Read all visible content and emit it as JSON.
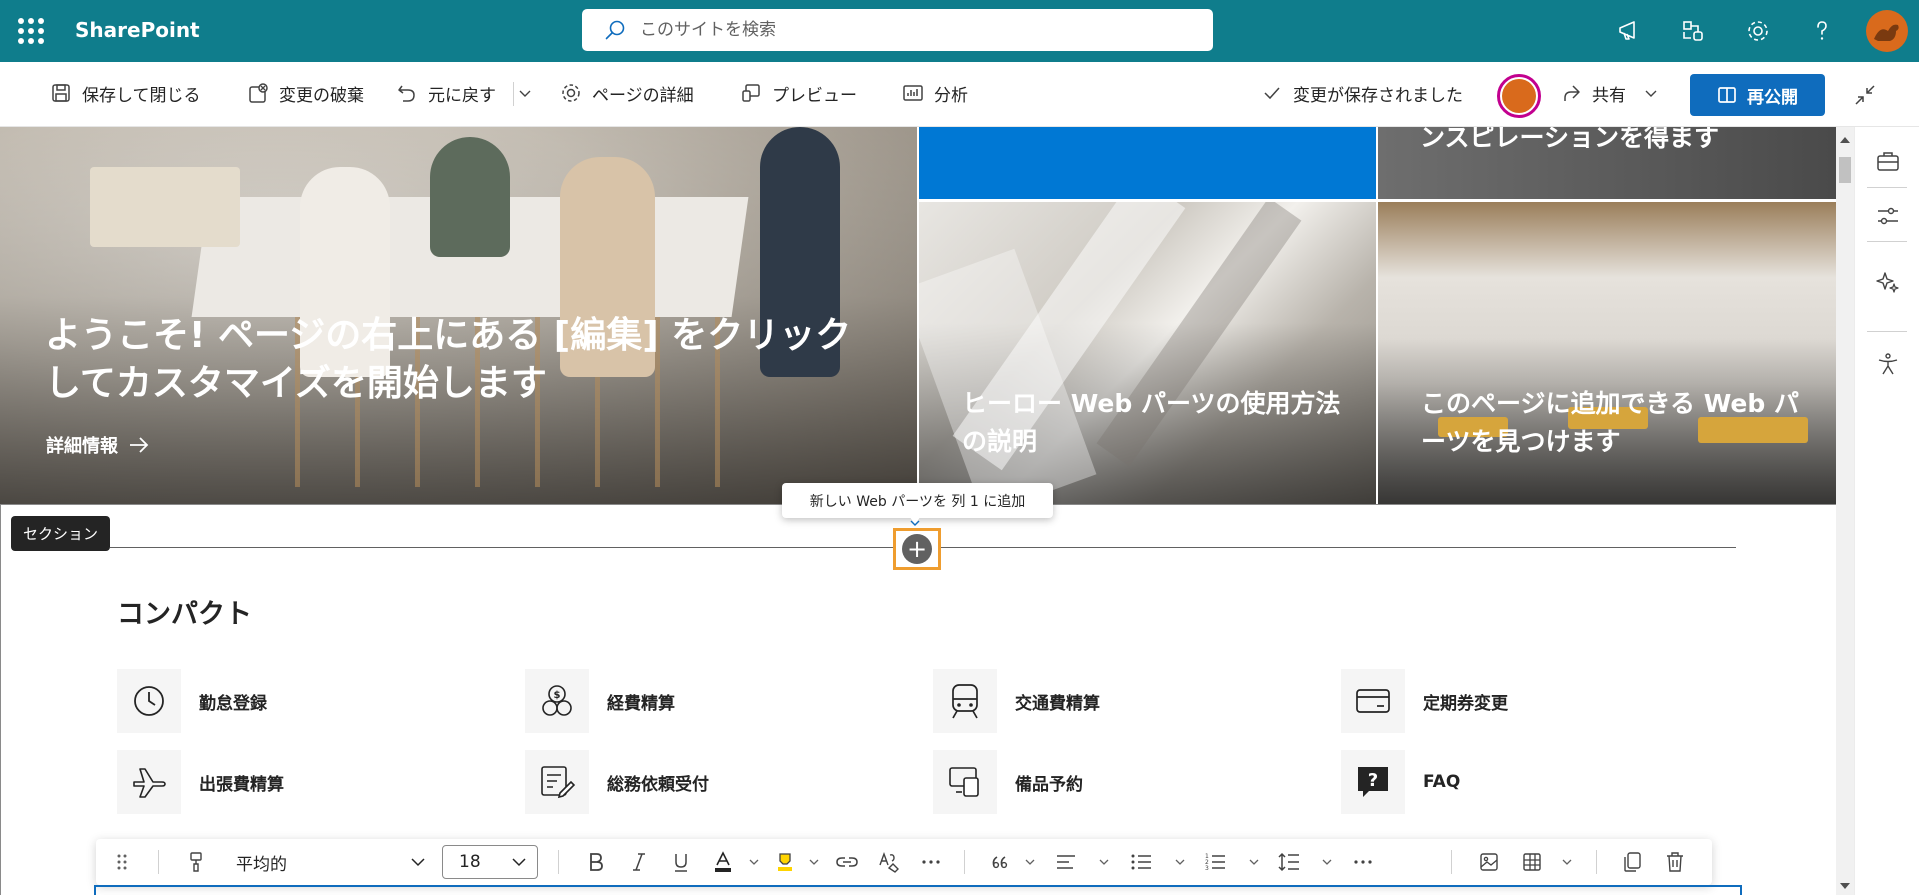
{
  "suite": {
    "brand": "SharePoint",
    "search_placeholder": "このサイトを検索",
    "icons": [
      "waffle-icon",
      "announcement-icon",
      "share-site-icon",
      "settings-icon",
      "help-icon"
    ]
  },
  "commandbar": {
    "save_close": "保存して閉じる",
    "discard": "変更の破棄",
    "undo": "元に戻す",
    "page_details": "ページの詳細",
    "preview": "プレビュー",
    "analytics": "分析",
    "saved_status": "変更が保存されました",
    "share": "共有",
    "republish": "再公開"
  },
  "hero": {
    "main_title": "ようこそ! ページの右上にある [編集] をクリックしてカスタマイズを開始します",
    "main_link": "詳細情報",
    "top_right_caption": "ンスピレーションを得ます",
    "tile2_caption": "ヒーロー Web パーツの使用方法の説明",
    "tile3_caption": "このページに追加できる Web パーツを見つけます"
  },
  "section": {
    "label": "セクション",
    "add_tooltip": "新しい Web パーツを 列 1 に追加",
    "add_symbol": "+"
  },
  "quicklinks": {
    "title": "コンパクト",
    "items": [
      {
        "label": "勤怠登録",
        "icon": "clock-icon"
      },
      {
        "label": "経費精算",
        "icon": "currency-exchange-icon"
      },
      {
        "label": "交通費精算",
        "icon": "train-icon"
      },
      {
        "label": "定期券変更",
        "icon": "card-icon"
      },
      {
        "label": "出張費精算",
        "icon": "airplane-icon"
      },
      {
        "label": "総務依頼受付",
        "icon": "form-edit-icon"
      },
      {
        "label": "備品予約",
        "icon": "devices-icon"
      },
      {
        "label": "FAQ",
        "icon": "question-board-icon"
      }
    ]
  },
  "format_toolbar": {
    "style": "平均的",
    "font_size": "18"
  },
  "colors": {
    "suite_bar": "#0f7d8c",
    "accent": "#0f6cbd",
    "hero_blue_tile": "#0078d4",
    "add_focus": "#ef9d2f",
    "avatar_ring": "#c2008f"
  }
}
